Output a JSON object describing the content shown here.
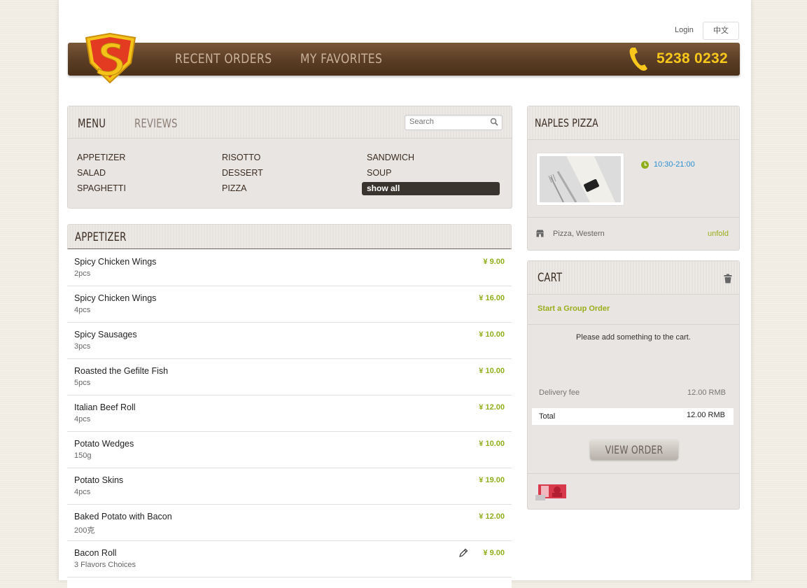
{
  "topbar": {
    "login_label": "Login",
    "language_label": "中文"
  },
  "header": {
    "nav": [
      "RECENT ORDERS",
      "MY FAVORITES"
    ],
    "phone": "5238 0232"
  },
  "menu_panel": {
    "tabs": [
      "MENU",
      "REVIEWS"
    ],
    "search_placeholder": "Search",
    "categories": [
      "APPETIZER",
      "RISOTTO",
      "SANDWICH",
      "SALAD",
      "DESSERT",
      "SOUP",
      "SPAGHETTI",
      "PIZZA"
    ],
    "show_all_label": "show all"
  },
  "list": {
    "title": "APPETIZER",
    "items": [
      {
        "name": "Spicy Chicken Wings",
        "desc": "2pcs",
        "price": "¥ 9.00"
      },
      {
        "name": "Spicy Chicken Wings",
        "desc": "4pcs",
        "price": "¥ 16.00"
      },
      {
        "name": "Spicy Sausages",
        "desc": "3pcs",
        "price": "¥ 10.00"
      },
      {
        "name": "Roasted the Gefilte Fish",
        "desc": "5pcs",
        "price": "¥ 10.00"
      },
      {
        "name": "Italian Beef Roll",
        "desc": "4pcs",
        "price": "¥ 12.00"
      },
      {
        "name": "Potato Wedges",
        "desc": "150g",
        "price": "¥ 10.00"
      },
      {
        "name": "Potato Skins",
        "desc": "4pcs",
        "price": "¥ 19.00"
      },
      {
        "name": "Baked Potato with Bacon",
        "desc": "200克",
        "price": "¥ 12.00"
      },
      {
        "name": "Bacon Roll",
        "desc": "3 Flavors Choices",
        "price": "¥ 9.00"
      }
    ]
  },
  "restaurant": {
    "name": "NAPLES PIZZA",
    "hours": "10:30-21:00",
    "cuisine": "Pizza, Western",
    "unfold_label": "unfold"
  },
  "cart": {
    "title": "CART",
    "group_order_label": "Start a Group Order",
    "empty_message": "Please add something to the cart.",
    "delivery_fee_label": "Delivery fee",
    "delivery_fee_value": "12.00 RMB",
    "total_label": "Total",
    "total_value": "12.00 RMB",
    "view_order_label": "VIEW ORDER"
  },
  "colors": {
    "header_brown": "#5a3d24",
    "accent_green": "#8fae1b",
    "phone_yellow": "#f7c81b",
    "link_blue": "#2a8fd0"
  }
}
